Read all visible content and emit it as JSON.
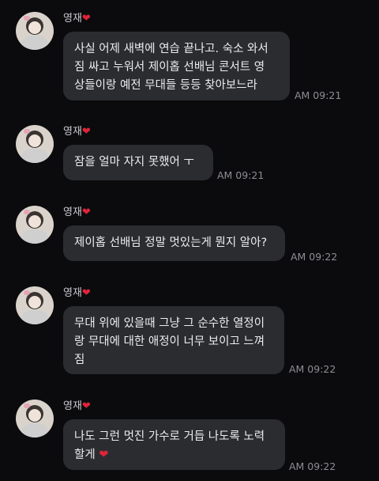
{
  "messages": [
    {
      "sender": "영재",
      "lines": [
        "사실 어제 새벽에 연습 끝나고. 숙소 와서",
        "짐 싸고 누워서 제이홉 선배님 콘서트 영",
        "상들이랑 예전 무대들 등등 찾아보느라"
      ],
      "time": "AM 09:21"
    },
    {
      "sender": "영재",
      "lines": [
        "잠을 얼마 자지 못했어 ㅜ"
      ],
      "time": "AM 09:21"
    },
    {
      "sender": "영재",
      "lines": [
        "제이홉 선배님 정말 멋있는게 뭔지 알아?"
      ],
      "time": "AM 09:22"
    },
    {
      "sender": "영재",
      "lines": [
        "무대 위에 있을때 그냥 그 순수한 열정이",
        "랑 무대에 대한 애정이 너무 보이고 느껴",
        "짐"
      ],
      "time": "AM 09:22"
    },
    {
      "sender": "영재",
      "lines": [
        "나도 그런 멋진 가수로 거듭 나도록 노력",
        "할게"
      ],
      "time": "AM 09:22"
    }
  ],
  "icons": {
    "heart": "red-heart-emoji",
    "heart_color": "#e0243a"
  }
}
